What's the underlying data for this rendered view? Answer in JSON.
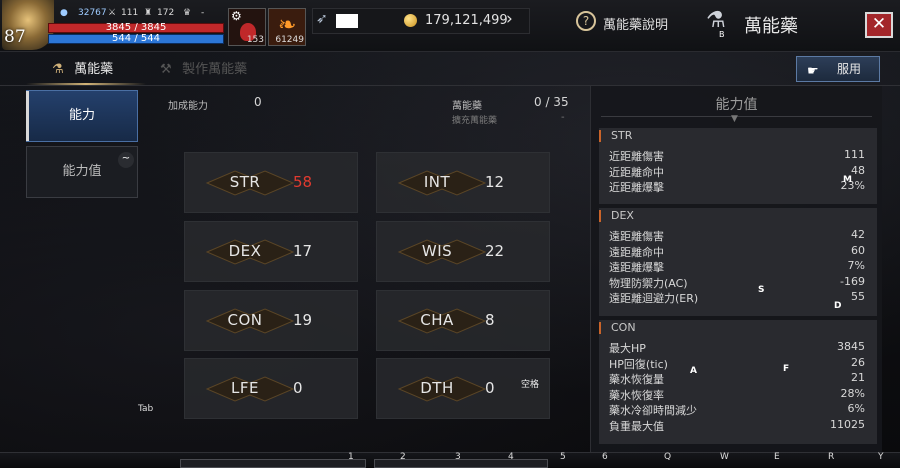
{
  "top": {
    "level": "87",
    "stat_a": "32767",
    "stat_b": "111",
    "stat_c": "172",
    "stat_d": "-",
    "hp_text": "3845 / 3845",
    "mp_text": "544 / 544",
    "buff1_count": "153",
    "buff2_count": "61249",
    "gold_amount": "179,121,499",
    "help_label": "萬能藥說明",
    "help_symbol": "?",
    "title": "萬能藥",
    "title_key": "B",
    "close_symbol": "✕"
  },
  "tabs": {
    "active_label": "萬能藥",
    "inactive_label": "製作萬能藥",
    "use_button": "服用"
  },
  "side": {
    "ability": "能力",
    "ability_value": "能力值",
    "tilde": "~",
    "tab_key": "Tab"
  },
  "middle": {
    "bonus_label": "加成能力",
    "bonus_value": "0",
    "potion_label": "萬能藥",
    "potion_value": "0 / 35",
    "potion_sub": "擴充萬能藥",
    "potion_dash": "-",
    "space_key": "空格"
  },
  "stats": [
    {
      "name": "STR",
      "value": "58",
      "highlight": true
    },
    {
      "name": "INT",
      "value": "12",
      "highlight": false
    },
    {
      "name": "DEX",
      "value": "17",
      "highlight": false
    },
    {
      "name": "WIS",
      "value": "22",
      "highlight": false
    },
    {
      "name": "CON",
      "value": "19",
      "highlight": false
    },
    {
      "name": "CHA",
      "value": "8",
      "highlight": false
    },
    {
      "name": "LFE",
      "value": "0",
      "highlight": false
    },
    {
      "name": "DTH",
      "value": "0",
      "highlight": false
    }
  ],
  "panel": {
    "title": "能力值",
    "str": {
      "header": "STR",
      "rows": [
        {
          "label": "近距離傷害",
          "value": "111"
        },
        {
          "label": "近距離命中",
          "value": "48"
        },
        {
          "label": "近距離爆擊",
          "value": "23%"
        }
      ]
    },
    "dex": {
      "header": "DEX",
      "rows": [
        {
          "label": "遠距離傷害",
          "value": "42"
        },
        {
          "label": "遠距離命中",
          "value": "60"
        },
        {
          "label": "遠距離爆擊",
          "value": "7%"
        },
        {
          "label": "物理防禦力(AC)",
          "value": "-169"
        },
        {
          "label": "遠距離迴避力(ER)",
          "value": "55"
        }
      ]
    },
    "con": {
      "header": "CON",
      "rows": [
        {
          "label": "最大HP",
          "value": "3845"
        },
        {
          "label": "HP回復(tic)",
          "value": "26"
        },
        {
          "label": "藥水恢復量",
          "value": "21"
        },
        {
          "label": "藥水恢復率",
          "value": "28%"
        },
        {
          "label": "藥水冷卻時間減少",
          "value": "6%"
        },
        {
          "label": "負重最大值",
          "value": "11025"
        }
      ]
    }
  },
  "hints": {
    "m": "M",
    "s": "S",
    "d": "D",
    "a": "A",
    "f": "F"
  },
  "hotkeys": [
    "1",
    "2",
    "3",
    "4",
    "5",
    "6",
    "Q",
    "W",
    "E",
    "R",
    "Y"
  ],
  "colors": {
    "accent_red": "#e03a2f",
    "close_red": "#a3262a",
    "hp_red": "#c0282a",
    "mp_blue": "#2c76d6",
    "active_blue": "#24406c",
    "section_marker": "#c9642a"
  }
}
